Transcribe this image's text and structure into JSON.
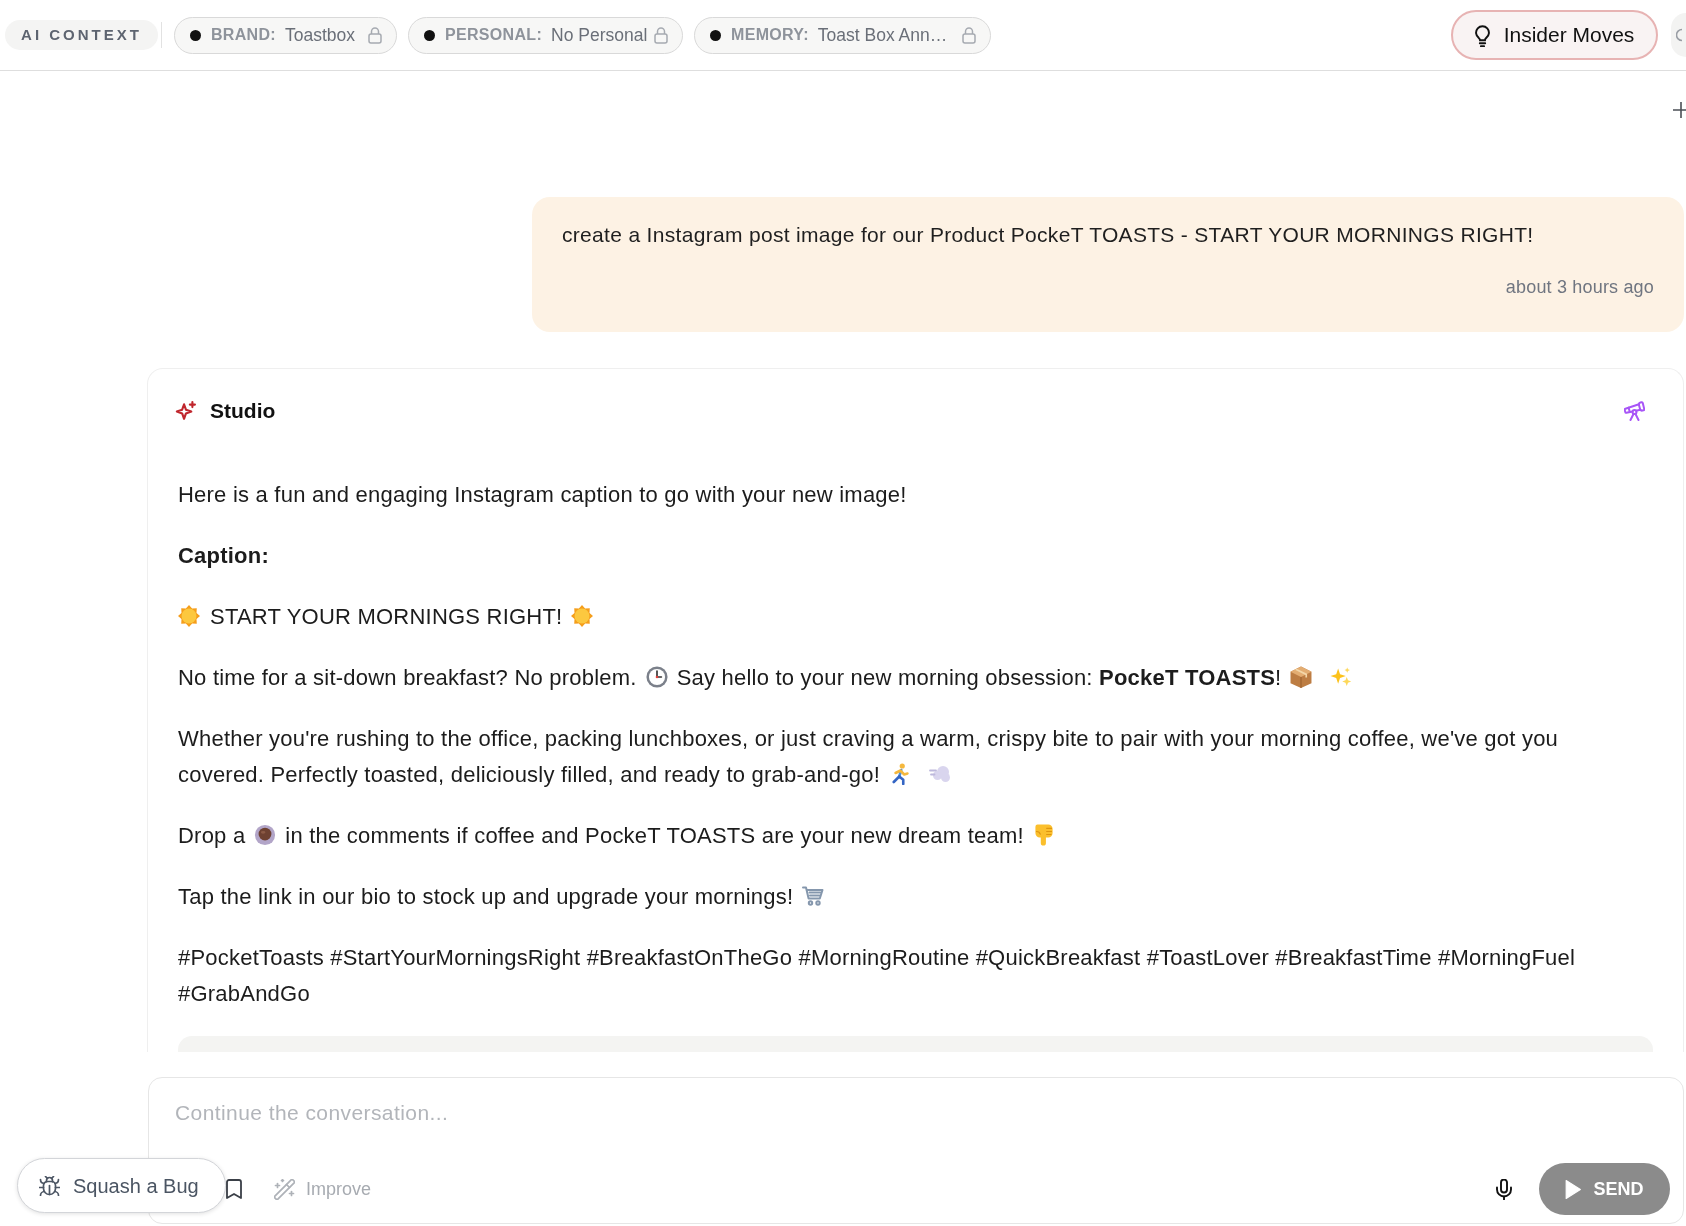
{
  "context_bar": {
    "label": "AI CONTEXT",
    "chips": [
      {
        "key": "BRAND:",
        "value": "Toastbox"
      },
      {
        "key": "PERSONAL:",
        "value": "No Personal"
      },
      {
        "key": "MEMORY:",
        "value": "Toast Box Ann…"
      }
    ]
  },
  "insider_button": {
    "label": "Insider Moves"
  },
  "user_message": {
    "text": "create a Instagram post image for our Product PockeT TOASTS - START YOUR MORNINGS RIGHT!",
    "time": "about 3 hours ago"
  },
  "assistant_message": {
    "author": "Studio",
    "has_image": true,
    "paragraphs": [
      [
        {
          "kind": "text",
          "text": "Here is a fun and engaging Instagram caption to go with your new image!"
        }
      ],
      [
        {
          "kind": "heading",
          "text": "Caption:"
        }
      ],
      [
        {
          "kind": "sun"
        },
        {
          "kind": "text",
          "text": "START YOUR MORNINGS RIGHT!"
        },
        {
          "kind": "sun"
        }
      ],
      [
        {
          "kind": "text",
          "text": "No time for a sit-down breakfast? No problem."
        },
        {
          "kind": "clock"
        },
        {
          "kind": "text",
          "text": "Say hello to your new morning obsession: **PockeT TOASTS**!"
        },
        {
          "kind": "package"
        },
        {
          "kind": "sparkles"
        }
      ],
      [
        {
          "kind": "line",
          "text": "Whether you're rushing to the office, packing lunchboxes, or just craving a warm, crispy bite to pair with your morning coffee, we've got you"
        },
        {
          "kind": "text",
          "text": "covered. Perfectly toasted, deliciously filled, and ready to grab-and-go!"
        },
        {
          "kind": "runner"
        },
        {
          "kind": "dash"
        }
      ],
      [
        {
          "kind": "text",
          "text": "Drop a"
        },
        {
          "kind": "coffee"
        },
        {
          "kind": "text",
          "text": "in the comments if coffee and PockeT TOASTS are your new dream team!"
        },
        {
          "kind": "pointer"
        }
      ],
      [
        {
          "kind": "text",
          "text": "Tap the link in our bio to stock up and upgrade your mornings!"
        },
        {
          "kind": "cart"
        }
      ],
      [
        {
          "kind": "text",
          "text": "#PocketToasts #StartYourMorningsRight #BreakfastOnTheGo #MorningRoutine #QuickBreakfast #ToastLover #BreakfastTime #MorningFuel #GrabAndGo"
        }
      ]
    ]
  },
  "composer": {
    "placeholder": "Continue the conversation...",
    "improve_label": "Improve",
    "send_label": "SEND"
  },
  "bug_button": {
    "label": "Squash a Bug"
  }
}
